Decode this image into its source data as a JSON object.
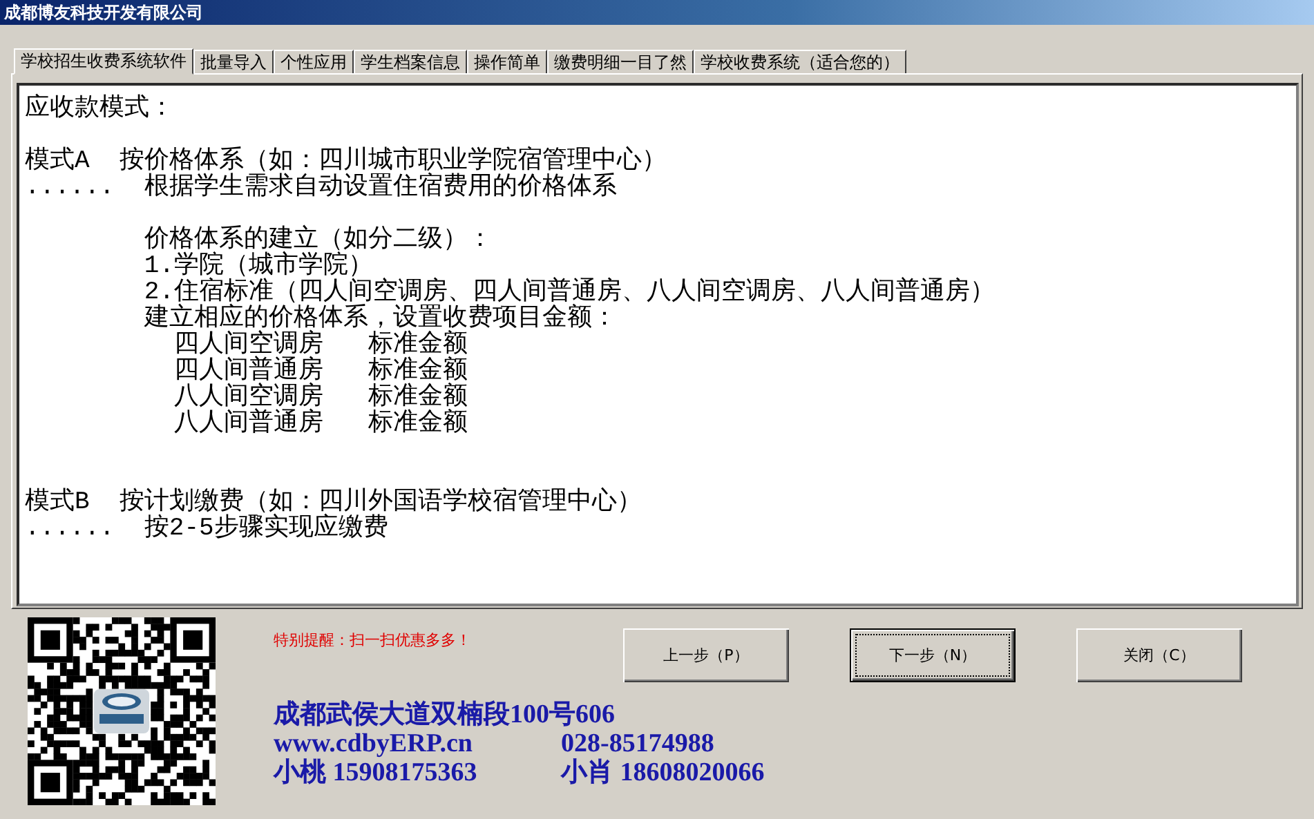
{
  "window": {
    "title": "成都博友科技开发有限公司"
  },
  "tabs": [
    {
      "label": "学校招生收费系统软件",
      "selected": true
    },
    {
      "label": "批量导入",
      "selected": false
    },
    {
      "label": "个性应用",
      "selected": false
    },
    {
      "label": "学生档案信息",
      "selected": false
    },
    {
      "label": "操作简单",
      "selected": false
    },
    {
      "label": "缴费明细一目了然",
      "selected": false
    },
    {
      "label": "学校收费系统（适合您的）",
      "selected": false
    }
  ],
  "text_blocks": [
    {
      "lines": [
        "应收款模式："
      ]
    },
    {
      "lines": [
        "模式A  按价格体系（如：四川城市职业学院宿管理中心）",
        "......  根据学生需求自动设置住宿费用的价格体系"
      ]
    },
    {
      "lines": [
        "        价格体系的建立（如分二级）：",
        "        1.学院（城市学院）",
        "        2.住宿标准（四人间空调房、四人间普通房、八人间空调房、八人间普通房）",
        "        建立相应的价格体系，设置收费项目金额：",
        "          四人间空调房   标准金额",
        "          四人间普通房   标准金额",
        "          八人间空调房   标准金额",
        "          八人间普通房   标准金额"
      ]
    },
    {
      "lines": [
        "模式B  按计划缴费（如：四川外国语学校宿管理中心）",
        "......  按2-5步骤实现应缴费"
      ]
    }
  ],
  "reminder": "特别提醒：扫一扫优惠多多！",
  "contact": {
    "address": "成都武侯大道双楠段100号606",
    "website": "www.cdbyERP.cn",
    "phone": "028-85174988",
    "contact_1": "小桃 15908175363",
    "contact_2": "小肖 18608020066"
  },
  "buttons": [
    {
      "label": "上一步（P）",
      "focused": false
    },
    {
      "label": "下一步（N）",
      "focused": true
    },
    {
      "label": "关闭（C）",
      "focused": false
    }
  ]
}
